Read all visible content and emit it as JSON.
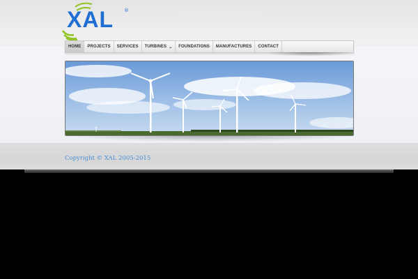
{
  "logo": {
    "text": "XAL",
    "mark": "®"
  },
  "nav": {
    "items": [
      {
        "label": "HOME",
        "active": true
      },
      {
        "label": "PROJECTS"
      },
      {
        "label": "SERVICES"
      },
      {
        "label": "TURBINES",
        "has_dropdown": true
      },
      {
        "label": "FOUNDATIONS"
      },
      {
        "label": "MANUFACTURES"
      },
      {
        "label": "CONTACT"
      }
    ],
    "chevron_icon": "chevron-down-icon"
  },
  "banner": {
    "image": "wind-turbines-photo"
  },
  "footer": {
    "copyright": "Copyright © XAL 2005-2015"
  },
  "colors": {
    "brand_blue": "#1f6ed4",
    "link_blue": "#4a8ed6",
    "logo_green": "#8fc31f"
  }
}
